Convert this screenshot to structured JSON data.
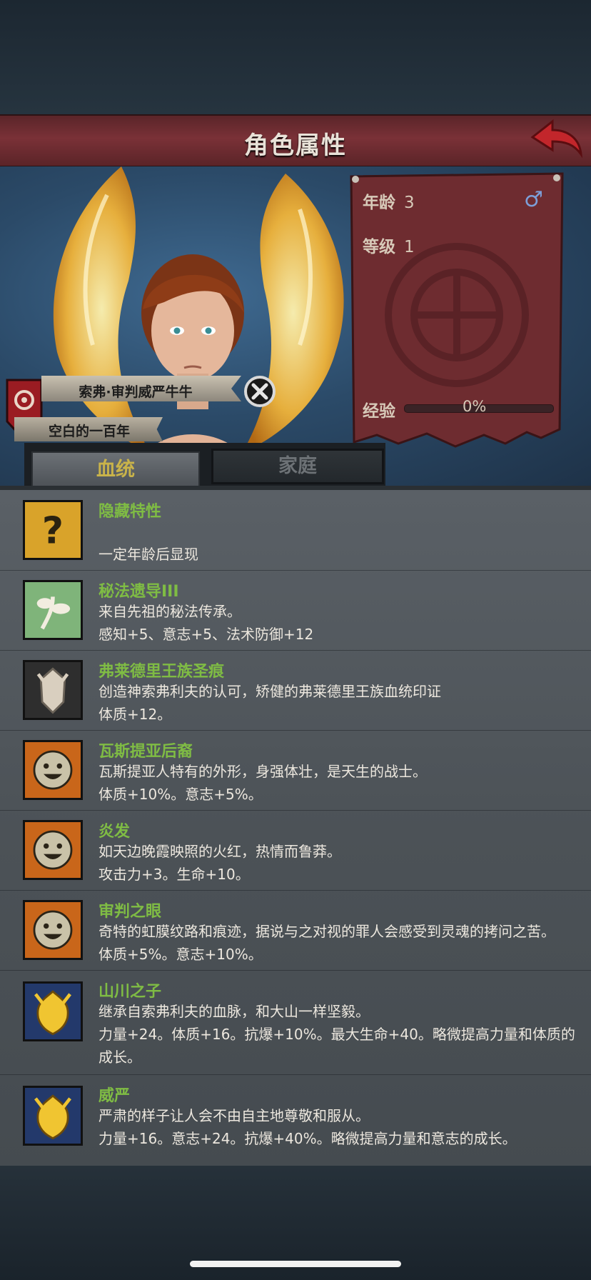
{
  "header": {
    "title": "角色属性"
  },
  "character": {
    "name": "索弗·审判威严牛牛",
    "subtitle": "空白的一百年",
    "age_label": "年龄",
    "age_value": "3",
    "level_label": "等级",
    "level_value": "1",
    "gender_symbol": "♂",
    "exp_label": "经验",
    "exp_percent": "0%",
    "exp_fraction": 0
  },
  "tabs": [
    {
      "label": "血统",
      "active": true
    },
    {
      "label": "家庭",
      "active": false
    }
  ],
  "traits": [
    {
      "name": "隐藏特性",
      "desc": "",
      "bonus": "一定年龄后显现",
      "icon": "question-icon"
    },
    {
      "name": "秘法遗导III",
      "desc": "来自先祖的秘法传承。",
      "bonus": "感知+5、意志+5、法术防御+12",
      "icon": "leaf-sprout-icon"
    },
    {
      "name": "弗莱德里王族圣痕",
      "desc": "创造神索弗利夫的认可，矫健的弗莱德里王族血统印证",
      "bonus": "体质+12。",
      "icon": "royal-crest-icon"
    },
    {
      "name": "瓦斯提亚后裔",
      "desc": "瓦斯提亚人特有的外形，身强体壮，是天生的战士。",
      "bonus": "体质+10%。意志+5%。",
      "icon": "smiley-icon"
    },
    {
      "name": "炎发",
      "desc": "如天边晚霞映照的火红，热情而鲁莽。",
      "bonus": "攻击力+3。生命+10。",
      "icon": "smiley-icon"
    },
    {
      "name": "审判之眼",
      "desc": "奇特的虹膜纹路和痕迹，据说与之对视的罪人会感受到灵魂的拷问之苦。",
      "bonus": "体质+5%。意志+10%。",
      "icon": "smiley-icon"
    },
    {
      "name": "山川之子",
      "desc": "继承自索弗利夫的血脉，和大山一样坚毅。",
      "bonus": "力量+24。体质+16。抗爆+10%。最大生命+40。略微提高力量和体质的成长。",
      "icon": "golden-crest-icon"
    },
    {
      "name": "威严",
      "desc": "严肃的样子让人会不由自主地尊敬和服从。",
      "bonus": "力量+16。意志+24。抗爆+40%。略微提高力量和意志的成长。",
      "icon": "golden-crest-icon"
    }
  ],
  "colors": {
    "trait_name": "#7fbc44",
    "tab_active_text": "#c9b34a",
    "title_bar": "#7a3137"
  }
}
